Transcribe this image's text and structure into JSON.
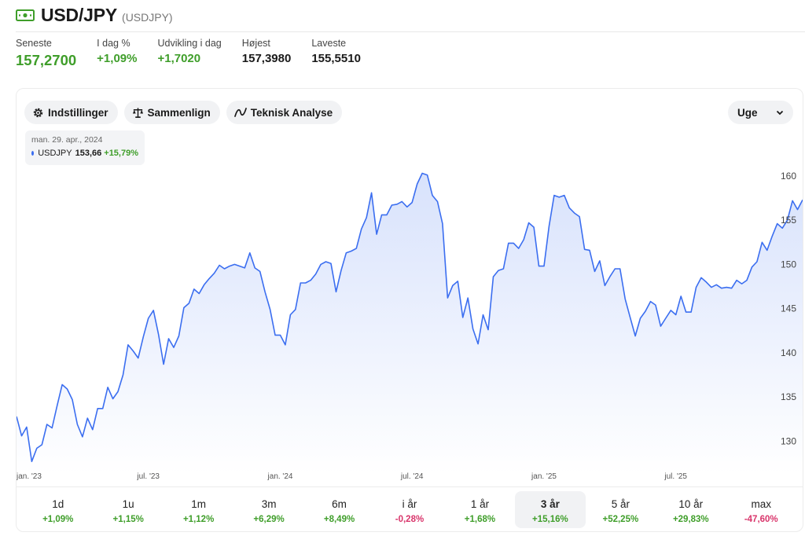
{
  "header": {
    "title": "USD/JPY",
    "symbol": "(USDJPY)"
  },
  "stats": [
    {
      "label": "Seneste",
      "value": "157,2700"
    },
    {
      "label": "I dag %",
      "value": "+1,09%"
    },
    {
      "label": "Udvikling i dag",
      "value": "+1,7020"
    },
    {
      "label": "Højest",
      "value": "157,3980"
    },
    {
      "label": "Laveste",
      "value": "155,5510"
    }
  ],
  "toolbar": {
    "settings_label": "Indstillinger",
    "compare_label": "Sammenlign",
    "technical_label": "Teknisk Analyse",
    "period_select": "Uge"
  },
  "tooltip": {
    "date": "man. 29. apr., 2024",
    "series": "USDJPY",
    "value": "153,66",
    "change": "+15,79%"
  },
  "periods": [
    {
      "label": "1d",
      "change": "+1,09%",
      "sign": "pos"
    },
    {
      "label": "1u",
      "change": "+1,15%",
      "sign": "pos"
    },
    {
      "label": "1m",
      "change": "+1,12%",
      "sign": "pos"
    },
    {
      "label": "3m",
      "change": "+6,29%",
      "sign": "pos"
    },
    {
      "label": "6m",
      "change": "+8,49%",
      "sign": "pos"
    },
    {
      "label": "i år",
      "change": "-0,28%",
      "sign": "neg"
    },
    {
      "label": "1 år",
      "change": "+1,68%",
      "sign": "pos"
    },
    {
      "label": "3 år",
      "change": "+15,16%",
      "sign": "pos",
      "active": true
    },
    {
      "label": "5 år",
      "change": "+52,25%",
      "sign": "pos"
    },
    {
      "label": "10 år",
      "change": "+29,83%",
      "sign": "pos"
    },
    {
      "label": "max",
      "change": "-47,60%",
      "sign": "neg"
    }
  ],
  "colors": {
    "line": "#3b6ef0",
    "positive": "#3f9e2a",
    "negative": "#d9356b"
  },
  "chart_data": {
    "type": "area",
    "series": [
      {
        "name": "USDJPY",
        "values": [
          132.8,
          130.6,
          131.6,
          127.7,
          129.2,
          129.6,
          131.9,
          131.5,
          134.0,
          136.4,
          135.9,
          134.7,
          131.9,
          130.5,
          132.6,
          131.3,
          133.7,
          133.7,
          136.1,
          134.8,
          135.6,
          137.5,
          140.9,
          140.2,
          139.4,
          141.8,
          143.9,
          144.8,
          142.1,
          138.7,
          141.6,
          140.6,
          141.9,
          145.1,
          145.6,
          147.2,
          146.7,
          147.7,
          148.4,
          149.0,
          149.9,
          149.5,
          149.8,
          150.0,
          149.8,
          149.6,
          151.3,
          149.6,
          149.2,
          146.9,
          144.9,
          142.0,
          142.0,
          140.9,
          144.3,
          144.9,
          147.9,
          147.9,
          148.2,
          148.9,
          150.0,
          150.3,
          150.1,
          146.9,
          149.3,
          151.3,
          151.5,
          151.8,
          154.0,
          155.3,
          158.1,
          153.4,
          155.6,
          155.6,
          156.7,
          156.8,
          157.1,
          156.5,
          157.0,
          159.1,
          160.3,
          160.1,
          157.8,
          157.1,
          154.6,
          146.2,
          147.6,
          148.1,
          144.0,
          146.2,
          142.7,
          141.0,
          144.3,
          142.6,
          148.6,
          149.3,
          149.5,
          152.4,
          152.4,
          151.8,
          152.8,
          154.7,
          154.2,
          149.8,
          149.8,
          154.3,
          157.8,
          157.6,
          157.8,
          156.4,
          155.8,
          155.4,
          151.7,
          151.6,
          149.2,
          150.4,
          147.6,
          148.6,
          149.5,
          149.5,
          146.1,
          144.0,
          141.9,
          143.9,
          144.7,
          145.8,
          145.4,
          143.0,
          143.9,
          144.8,
          144.3,
          146.4,
          144.6,
          144.6,
          147.4,
          148.5,
          148.0,
          147.4,
          147.7,
          147.3,
          147.4,
          147.3,
          148.2,
          147.8,
          148.2,
          149.7,
          150.3,
          152.5,
          151.6,
          153.2,
          154.6,
          154.1,
          155.0,
          157.2,
          156.2,
          157.3
        ]
      }
    ],
    "x_tick_labels": [
      "jan. '23",
      "jul. '23",
      "jan. '24",
      "jul. '24",
      "jan. '25",
      "jul. '25"
    ],
    "x_tick_index": [
      0,
      26,
      52,
      78,
      104,
      130
    ],
    "y_ticks": [
      130,
      135,
      140,
      145,
      150,
      155,
      160
    ],
    "ylim": [
      126.3,
      162.3
    ],
    "grid": false,
    "fill": "gradient"
  }
}
